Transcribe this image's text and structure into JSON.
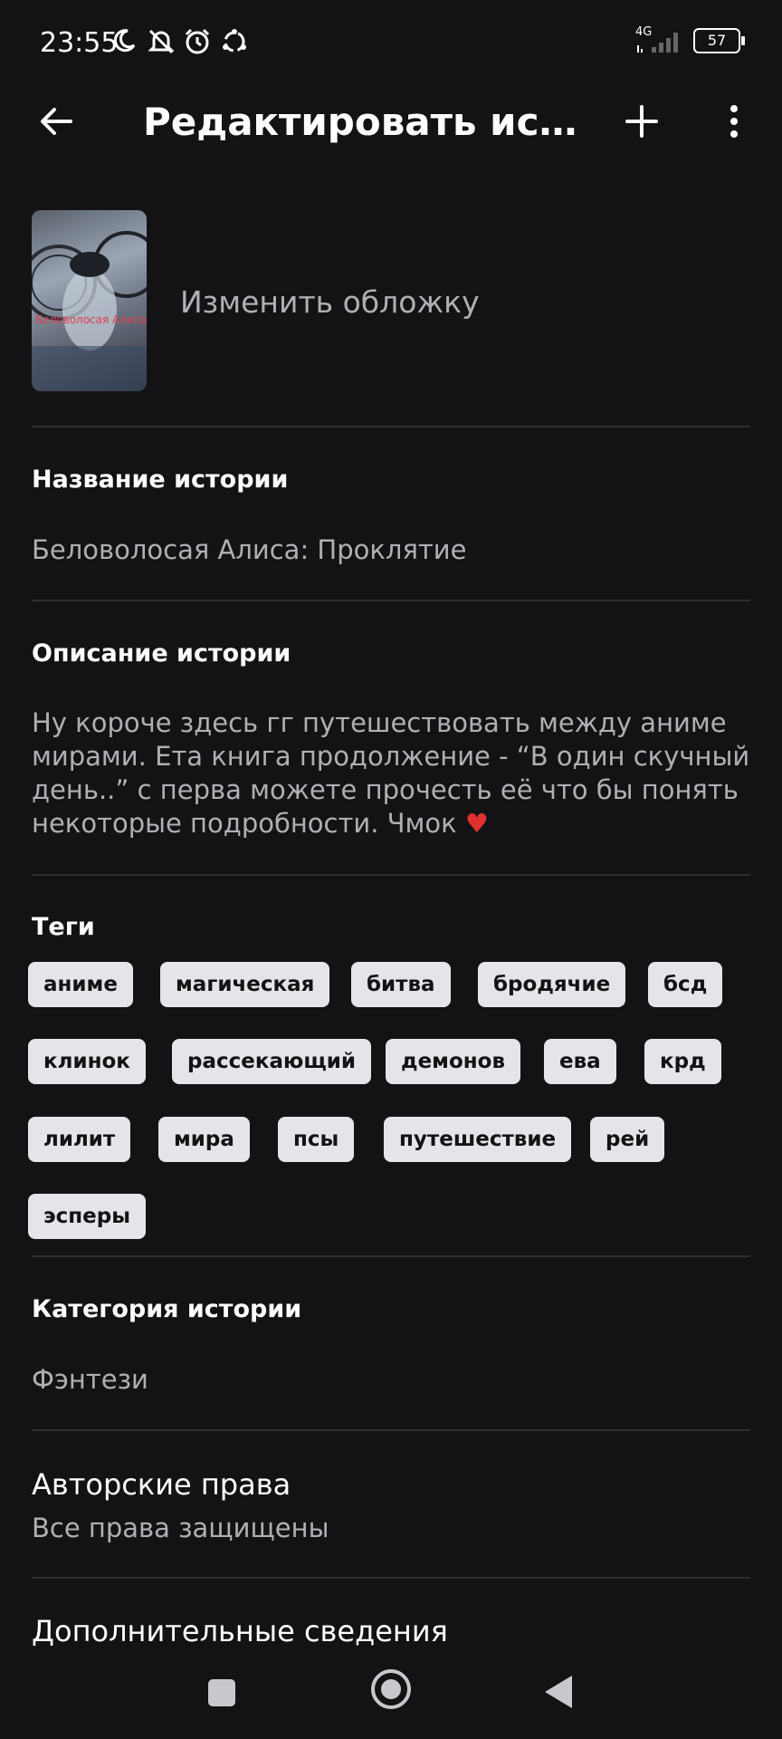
{
  "status_bar": {
    "time": "23:55",
    "network": "4G",
    "battery": "57",
    "icons": [
      "moon-icon",
      "bell-off-icon",
      "alarm-icon",
      "sync-icon"
    ]
  },
  "app_bar": {
    "title": "Редактировать истор…",
    "icons": [
      "back-arrow-icon",
      "add-icon",
      "more-vert-icon"
    ]
  },
  "cover": {
    "overlay_text": "Беловолосая Алиса: Проклятие",
    "change_label": "Изменить обложку"
  },
  "story": {
    "title_label": "Название истории",
    "title_value": "Беловолосая Алиса: Проклятие",
    "description_label": "Описание истории",
    "description_value": "Ну короче здесь гг путешествовать между аниме мирами. Ета книга продолжение - “В один скучный день..” с перва можете прочесть её что бы понять некоторые подробности. Чмок",
    "description_emoji": "♥",
    "tags_label": "Теги",
    "tags": [
      "аниме",
      "магическая",
      "битва",
      "бродячие",
      "бсд",
      "клинок",
      "рассекающий",
      "демонов",
      "ева",
      "крд",
      "лилит",
      "мира",
      "псы",
      "путешествие",
      "рей",
      "эсперы"
    ],
    "category_label": "Категория истории",
    "category_value": "Фэнтези",
    "copyright_label": "Авторские права",
    "copyright_value": "Все права защищены",
    "extra_label": "Дополнительные сведения"
  },
  "colors": {
    "background": "#131215",
    "tag_bg": "#e6e4e8",
    "secondary_text": "#b0b0b4",
    "heart": "#e0302f"
  }
}
